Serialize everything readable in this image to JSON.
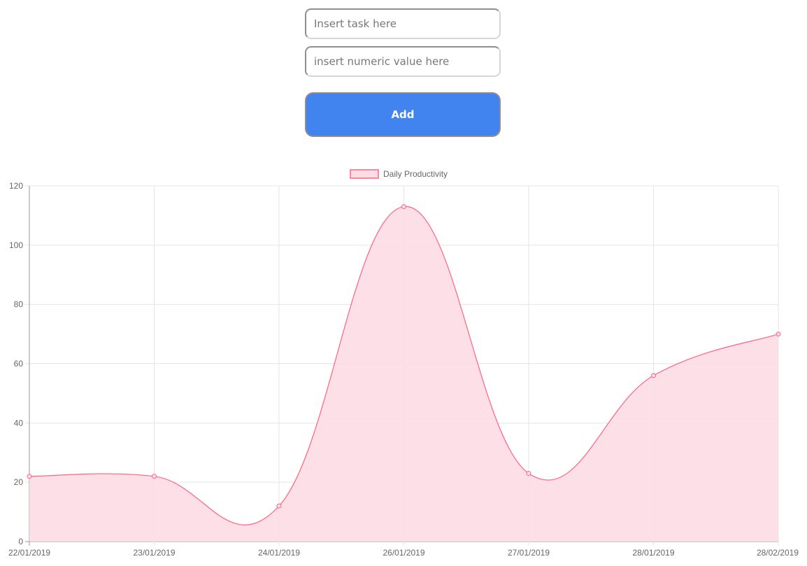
{
  "form": {
    "task_placeholder": "Insert task here",
    "task_value": "",
    "value_placeholder": "insert numeric value here",
    "value_value": "",
    "add_label": "Add"
  },
  "colors": {
    "button": "#4184f0",
    "series_line": "#ff6384",
    "series_fill": "#fddde4",
    "grid": "#e5e5e5",
    "text": "#666666"
  },
  "chart_data": {
    "type": "area",
    "x": [
      "22/01/2019",
      "23/01/2019",
      "24/01/2019",
      "26/01/2019",
      "27/01/2019",
      "28/01/2019",
      "28/02/2019"
    ],
    "series": [
      {
        "name": "Daily Productivity",
        "values": [
          22,
          22,
          12,
          113,
          23,
          56,
          70
        ]
      }
    ],
    "ylim": [
      0,
      120
    ],
    "yticks": [
      0,
      20,
      40,
      60,
      80,
      100,
      120
    ],
    "grid": true,
    "legend": "top-center",
    "title": "",
    "xlabel": "",
    "ylabel": ""
  }
}
